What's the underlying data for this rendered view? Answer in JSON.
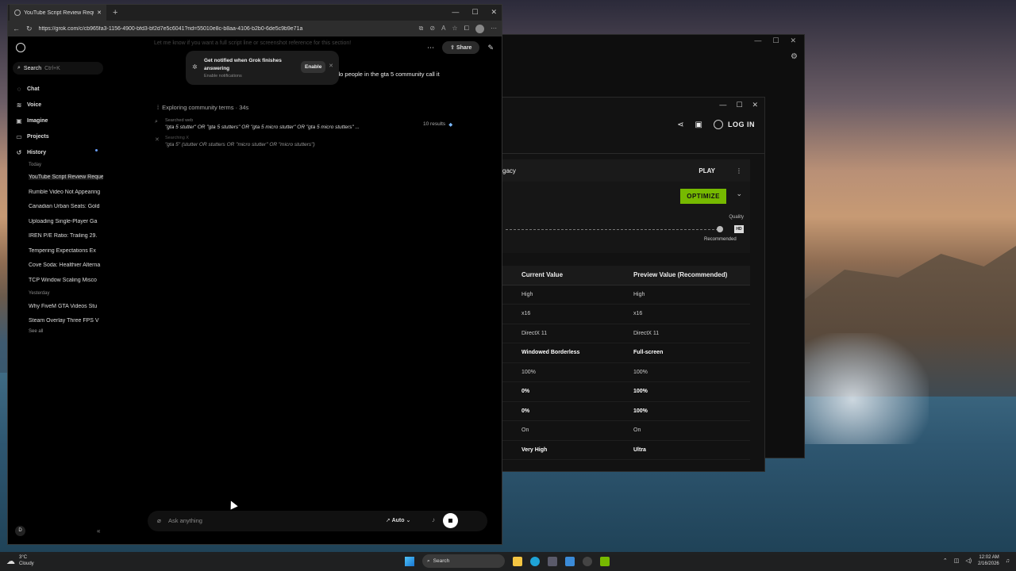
{
  "browser": {
    "tab_title": "YouTube Script Review Request - G",
    "url": "https://grok.com/c/cb965fa3-1156-4900-bfd3-bf2d7e5c6041?rid=55010e8c-b8aa-4106-b2b0-6de5c9b9e71a"
  },
  "sidebar": {
    "search_label": "Search",
    "search_shortcut": "Ctrl+K",
    "nav": [
      "Chat",
      "Voice",
      "Imagine",
      "Projects",
      "History"
    ],
    "today_label": "Today",
    "yesterday_label": "Yesterday",
    "today_items": [
      "YouTube Script Review Request",
      "Rumble Video Not Appearing",
      "Canadian Urban Seats: Gold",
      "Uploading Single-Player Ga",
      "IREN P/E Ratio: Trailing 29.",
      "Tempering Expectations Ex",
      "Cove Soda: Healthier Alterna",
      "TCP Window Scaling Misco"
    ],
    "yesterday_items": [
      "Why FiveM GTA Videos Stu",
      "Steam Overlay Three FPS V"
    ],
    "see_all": "See all",
    "user_initial": "D"
  },
  "chat": {
    "faded_text": "Let me know if you want a full script line or screenshot reference for this section!",
    "share_label": "Share",
    "notification": {
      "title": "Get notified when Grok finishes answering",
      "subtitle": "Enable notifications",
      "button": "Enable"
    },
    "user_message_tail": "do people in the gta 5 community call it",
    "thinking": "Exploring community terms · 34s",
    "searched_web_label": "Searched web",
    "searched_query": "\"gta 5 stutter\" OR \"gta 5 stutters\" OR \"gta 5 micro stutter\" OR \"gta 5 micro stutters\" ...",
    "results": "10 results",
    "searching_label": "Searching X",
    "searching_query": "\"gta 5\" (stutter OR stutters OR \"micro stutter\" OR \"micro stutters\")",
    "composer_placeholder": "Ask anything",
    "mode": "Auto"
  },
  "nvidia": {
    "login": "LOG IN",
    "game_name": "gacy",
    "play": "PLAY",
    "optimize": "OPTIMIZE",
    "quality": "Quality",
    "recommended": "Recommended",
    "hd": "HD",
    "col_current": "Current Value",
    "col_preview": "Preview Value (Recommended)",
    "rows": [
      {
        "cur": "High",
        "prev": "High",
        "bold": false
      },
      {
        "cur": "x16",
        "prev": "x16",
        "bold": false
      },
      {
        "cur": "DirectX 11",
        "prev": "DirectX 11",
        "bold": false
      },
      {
        "cur": "Windowed Borderless",
        "prev": "Full-screen",
        "bold": true
      },
      {
        "cur": "100%",
        "prev": "100%",
        "bold": false
      },
      {
        "cur": "0%",
        "prev": "100%",
        "bold": true
      },
      {
        "cur": "0%",
        "prev": "100%",
        "bold": true
      },
      {
        "cur": "On",
        "prev": "On",
        "bold": false
      },
      {
        "cur": "Very High",
        "prev": "Ultra",
        "bold": true
      }
    ]
  },
  "taskbar": {
    "temp": "3°C",
    "weather": "Cloudy",
    "search": "Search",
    "time": "12:02 AM",
    "date": "2/16/2026"
  },
  "colors": {
    "accent_green": "#76b900",
    "bg": "#000000"
  }
}
